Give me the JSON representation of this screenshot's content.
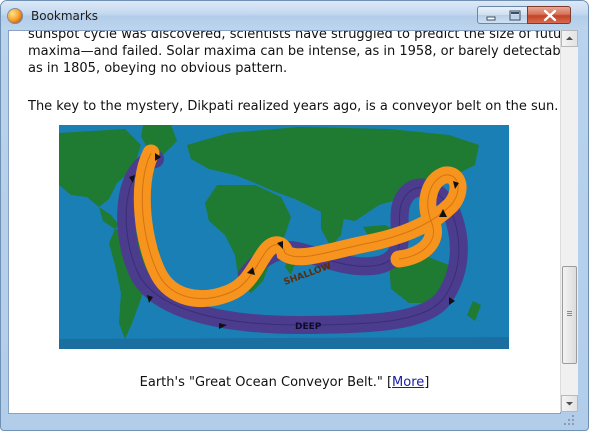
{
  "window": {
    "title": "Bookmarks"
  },
  "content": {
    "partial_line": "sunspot cycle was discovered, scientists have struggled to predict the size of future",
    "line2": "maxima—and failed. Solar maxima can be intense, as in 1958, or barely detectable,",
    "line3": "as in 1805, obeying no obvious pattern.",
    "para2": "The key to the mystery, Dikpati realized years ago, is a conveyor belt on the sun.",
    "figure": {
      "shallow_label": "SHALLOW",
      "deep_label": "DEEP"
    },
    "caption_text": "Earth's \"Great Ocean Conveyor Belt.\" [",
    "caption_link": "More",
    "caption_end": "]"
  },
  "icons": {
    "app": "firefox-icon",
    "minimize": "minimize-icon",
    "maximize": "maximize-icon",
    "close": "close-icon"
  },
  "colors": {
    "ocean": "#1a7fb4",
    "land": "#1f7a32",
    "shallow_belt": "#f7941d",
    "deep_belt": "#4b3c8e",
    "link": "#1a1aa6"
  }
}
